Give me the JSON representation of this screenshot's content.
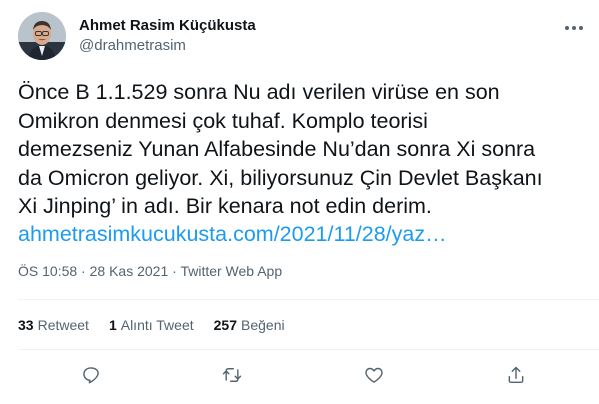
{
  "author": {
    "name": "Ahmet Rasim Küçükusta",
    "handle": "@drahmetrasim"
  },
  "tweet": {
    "lines": [
      "Önce B 1.1.529 sonra Nu adı verilen virüse en son",
      "Omikron denmesi çok tuhaf. Komplo teorisi",
      "demezseniz Yunan Alfabesinde Nu’dan sonra Xi sonra",
      "da Omicron geliyor. Xi, biliyorsunuz Çin Devlet Başkanı",
      "Xi Jinping’ in adı. Bir kenara not edin derim."
    ],
    "link": "ahmetrasimkucukusta.com/2021/11/28/yaz…"
  },
  "meta": {
    "time": "ÖS 10:58",
    "sep1": "·",
    "date": "28 Kas 2021",
    "sep2": "·",
    "source": "Twitter Web App"
  },
  "stats": {
    "retweets_count": "33",
    "retweets_label": "Retweet",
    "quotes_count": "1",
    "quotes_label": "Alıntı Tweet",
    "likes_count": "257",
    "likes_label": "Beğeni"
  },
  "icons": {
    "more": "more-horizontal-icon",
    "reply": "reply-icon",
    "retweet": "retweet-icon",
    "like": "heart-icon",
    "share": "share-icon"
  },
  "colors": {
    "text": "#0f1419",
    "secondary": "#536471",
    "link": "#1d9bf0",
    "divider": "#eff3f4"
  }
}
